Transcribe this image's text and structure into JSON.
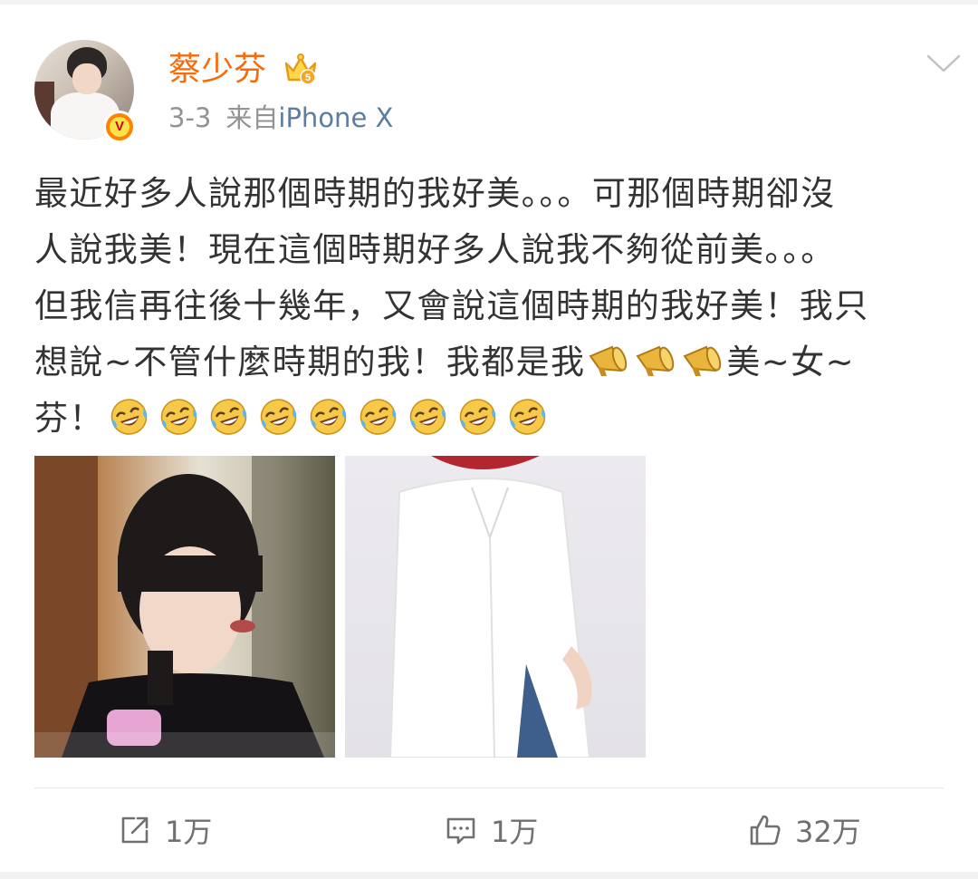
{
  "post": {
    "user": {
      "name": "蔡少芬",
      "verified_mark": "V",
      "badge": "crown-5-icon",
      "name_color": "#f86a0d"
    },
    "meta": {
      "date": "3-3",
      "source_prefix": "来自",
      "device": "iPhone X"
    },
    "text_lines": [
      "最近好多人說那個時期的我好美。。。可那個時期卻沒",
      "人說我美！現在這個時期好多人說我不夠從前美。。。",
      "但我信再往後十幾年，又會說這個時期的我好美！我只",
      "想說~不管什麼時期的我！我都是我",
      "美~女~",
      "芬！"
    ],
    "images": [
      "photo-retro-portrait",
      "photo-white-shirt"
    ],
    "actions": {
      "repost_count": "1万",
      "comment_count": "1万",
      "like_count": "32万"
    }
  },
  "colors": {
    "accent": "#f86a0d",
    "link": "#5c7d9f",
    "text": "#333333",
    "muted": "#939393"
  }
}
